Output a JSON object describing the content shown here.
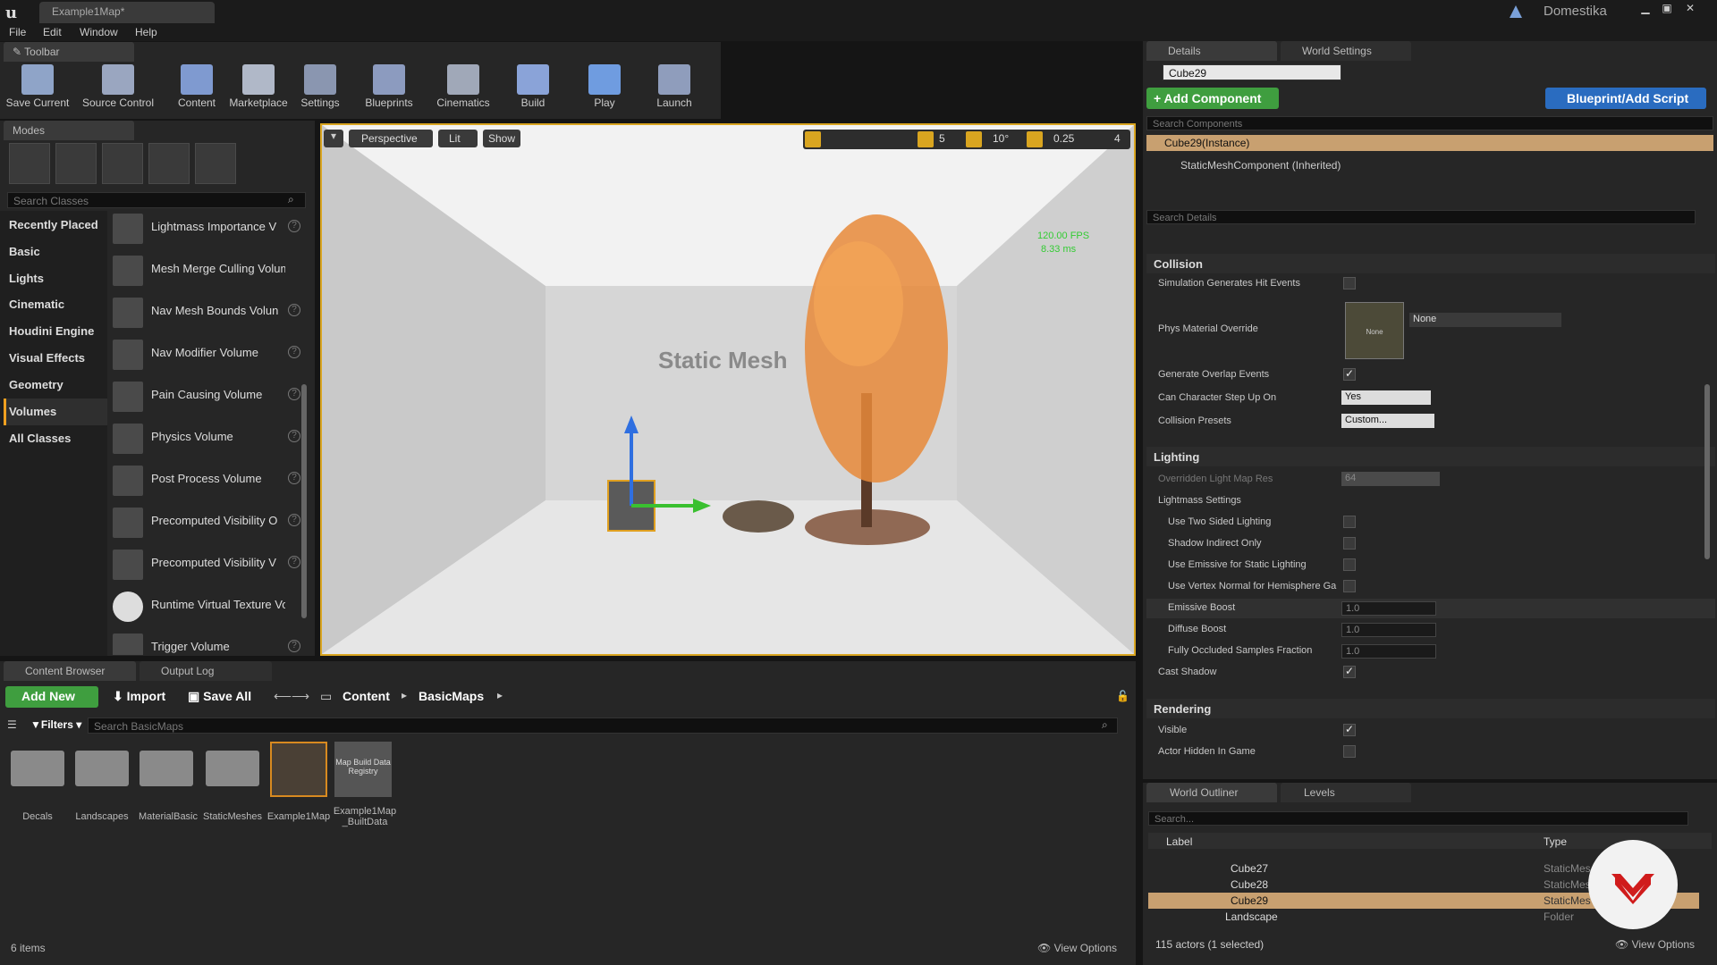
{
  "app": {
    "map_tab": "Example1Map*",
    "account": "Domestika"
  },
  "menu": [
    "File",
    "Edit",
    "Window",
    "Help"
  ],
  "toolbar": {
    "tab": "Toolbar",
    "buttons": [
      "Save Current",
      "Source Control",
      "Content",
      "Marketplace",
      "Settings",
      "Blueprints",
      "Cinematics",
      "Build",
      "Play",
      "Launch"
    ]
  },
  "modes": {
    "tab": "Modes",
    "search_placeholder": "Search Classes",
    "categories": [
      "Recently Placed",
      "Basic",
      "Lights",
      "Cinematic",
      "Houdini Engine",
      "Visual Effects",
      "Geometry",
      "Volumes",
      "All Classes"
    ],
    "selected_category": "Volumes",
    "items": [
      "Lightmass Importance V",
      "Mesh Merge Culling Volume",
      "Nav Mesh Bounds Volun",
      "Nav Modifier Volume",
      "Pain Causing Volume",
      "Physics Volume",
      "Post Process Volume",
      "Precomputed Visibility O",
      "Precomputed Visibility V",
      "Runtime Virtual Texture Volu",
      "Trigger Volume"
    ]
  },
  "viewport": {
    "perspective": "Perspective",
    "lit": "Lit",
    "show": "Show",
    "fps": "120.00 FPS",
    "ms": "8.33 ms",
    "overlay_text": "Static Mesh",
    "grid": "5",
    "angle": "10°",
    "scale": "0.25",
    "cam": "4"
  },
  "content_browser": {
    "tab": "Content Browser",
    "output_tab": "Output Log",
    "add_new": "Add New",
    "import": "Import",
    "save_all": "Save All",
    "path": [
      "Content",
      "BasicMaps"
    ],
    "filters": "Filters",
    "search_placeholder": "Search BasicMaps",
    "assets": [
      "Decals",
      "Landscapes",
      "MaterialBasic",
      "StaticMeshes",
      "Example1Map",
      "Example1Map _BuiltData"
    ],
    "registry_label": "Map Build Data Registry",
    "count": "6 items",
    "view_options": "View Options"
  },
  "details": {
    "tab": "Details",
    "world_tab": "World Settings",
    "name": "Cube29",
    "add_component": "+ Add Component",
    "blueprint": "Blueprint/Add Script",
    "search_components": "Search Components",
    "instance": "Cube29(Instance)",
    "component": "StaticMeshComponent (Inherited)",
    "search_details": "Search Details",
    "collision": {
      "title": "Collision",
      "sim_events": "Simulation Generates Hit Events",
      "phys_mat": "Phys Material Override",
      "phys_none": "None",
      "phys_thumb": "None",
      "overlap": "Generate Overlap Events",
      "step_up": "Can Character Step Up On",
      "step_up_val": "Yes",
      "presets": "Collision Presets",
      "presets_val": "Custom..."
    },
    "lighting": {
      "title": "Lighting",
      "lightmap_res": "Overridden Light Map Res",
      "lightmap_val": "64",
      "lightmass": "Lightmass Settings",
      "two_sided": "Use Two Sided Lighting",
      "shadow_indirect": "Shadow Indirect Only",
      "emissive_static": "Use Emissive for Static Lighting",
      "vertex_normal": "Use Vertex Normal for Hemisphere Ga",
      "emissive_boost": "Emissive Boost",
      "emissive_val": "1.0",
      "diffuse_boost": "Diffuse Boost",
      "diffuse_val": "1.0",
      "occluded": "Fully Occluded Samples Fraction",
      "occluded_val": "1.0",
      "cast_shadow": "Cast Shadow"
    },
    "rendering": {
      "title": "Rendering",
      "visible": "Visible",
      "hidden": "Actor Hidden In Game"
    }
  },
  "outliner": {
    "tab": "World Outliner",
    "levels_tab": "Levels",
    "search_placeholder": "Search...",
    "col_label": "Label",
    "col_type": "Type",
    "rows": [
      {
        "label": "Cube27",
        "type": "StaticMes"
      },
      {
        "label": "Cube28",
        "type": "StaticMes"
      },
      {
        "label": "Cube29",
        "type": "StaticMes"
      },
      {
        "label": "Landscape",
        "type": "Folder"
      }
    ],
    "status": "115 actors (1 selected)",
    "view_options": "View Options"
  }
}
